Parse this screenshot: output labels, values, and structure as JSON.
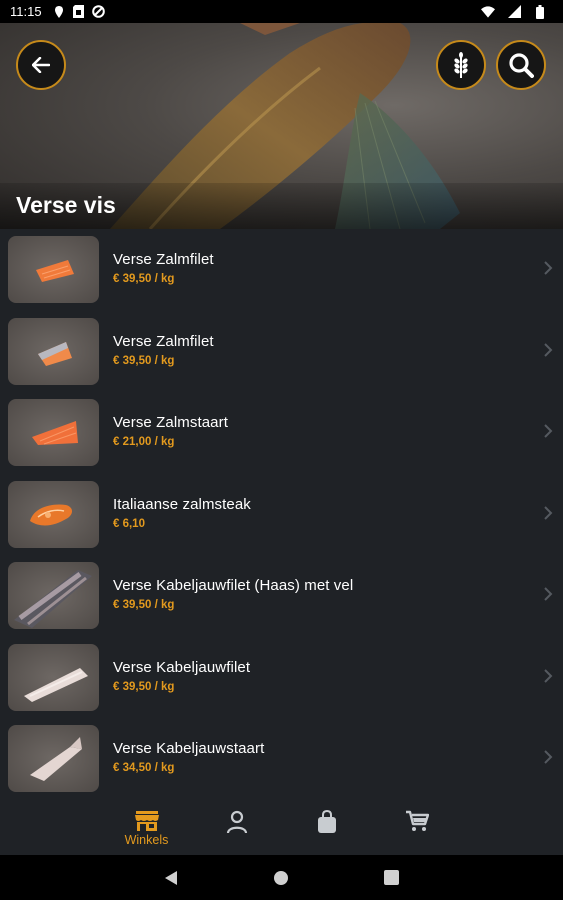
{
  "status": {
    "time": "11:15"
  },
  "header": {
    "title": "Verse vis"
  },
  "products": [
    {
      "name": "Verse Zalmfilet",
      "price": "€ 39,50 / kg",
      "thumb": "salmon-fillet"
    },
    {
      "name": "Verse Zalmfilet",
      "price": "€ 39,50 / kg",
      "thumb": "salmon-fillet-skin"
    },
    {
      "name": "Verse Zalmstaart",
      "price": "€ 21,00 / kg",
      "thumb": "salmon-tail"
    },
    {
      "name": "Italiaanse zalmsteak",
      "price": "€ 6,10",
      "thumb": "salmon-steak"
    },
    {
      "name": "Verse Kabeljauwfilet (Haas) met vel",
      "price": "€ 39,50 / kg",
      "thumb": "cod-fillet-skin"
    },
    {
      "name": "Verse Kabeljauwfilet",
      "price": "€ 39,50 / kg",
      "thumb": "cod-fillet"
    },
    {
      "name": "Verse Kabeljauwstaart",
      "price": "€ 34,50 / kg",
      "thumb": "cod-tail"
    }
  ],
  "bottom_nav": {
    "active_label": "Winkels"
  },
  "colors": {
    "accent": "#e39a1e",
    "background": "#1f2226"
  }
}
